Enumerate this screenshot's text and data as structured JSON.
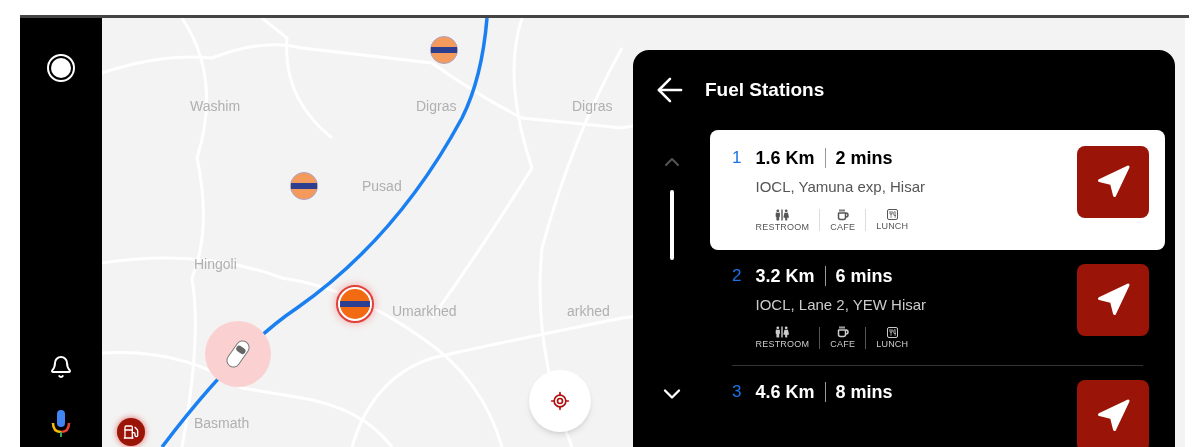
{
  "map": {
    "labels": [
      "Washim",
      "Digras",
      "Digras",
      "Pusad",
      "Hingoli",
      "Umarkhed",
      "arkhed",
      "Basmath"
    ]
  },
  "panel": {
    "title": "Fuel Stations",
    "stations": [
      {
        "number": "1",
        "distance": "1.6 Km",
        "time": "2 mins",
        "address": "IOCL, Yamuna exp, Hisar",
        "selected": true,
        "amenities": [
          {
            "kind": "restroom",
            "label": "RESTROOM"
          },
          {
            "kind": "cafe",
            "label": "CAFE"
          },
          {
            "kind": "lunch",
            "label": "LUNCH"
          }
        ]
      },
      {
        "number": "2",
        "distance": "3.2 Km",
        "time": "6 mins",
        "address": "IOCL, Lane 2, YEW Hisar",
        "selected": false,
        "amenities": [
          {
            "kind": "restroom",
            "label": "RESTROOM"
          },
          {
            "kind": "cafe",
            "label": "CAFE"
          },
          {
            "kind": "lunch",
            "label": "LUNCH"
          }
        ]
      },
      {
        "number": "3",
        "distance": "4.6 Km",
        "time": "8 mins",
        "selected": false
      }
    ]
  }
}
